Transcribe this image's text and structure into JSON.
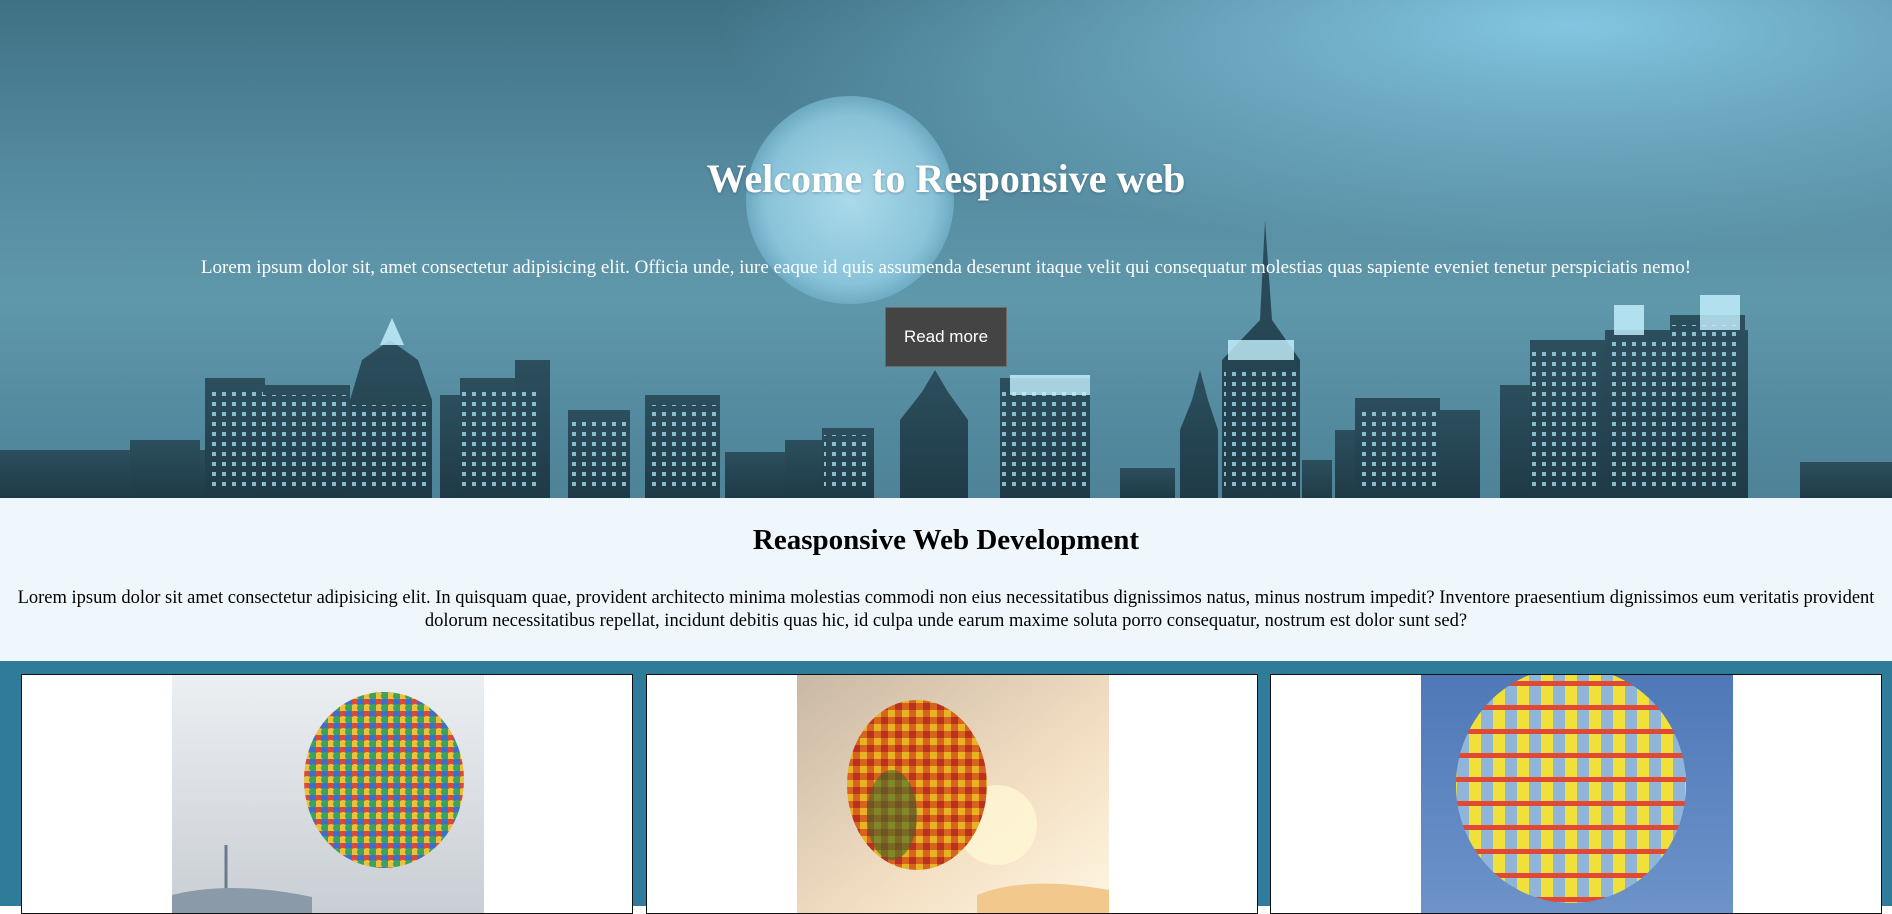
{
  "hero": {
    "title": "Welcome to Responsive web",
    "text": "Lorem ipsum dolor sit, amet consectetur adipisicing elit. Officia unde, iure eaque id quis assumenda deserunt itaque velit qui consequatur molestias quas sapiente eveniet tenetur perspiciatis nemo!",
    "button_label": "Read more",
    "background": "night-city-skyline-image"
  },
  "intro": {
    "title": "Reasponsive Web Development",
    "text": "Lorem ipsum dolor sit amet consectetur adipisicing elit. In quisquam quae, provident architecto minima molestias commodi non eius necessitatibus dignissimos natus, minus nostrum impedit? Inventore praesentium dignissimos eum veritatis provident dolorum necessitatibus repellat, incidunt debitis quas hic, id culpa unde earum maxime soluta porro consequatur, nostrum est dolor sunt sed?"
  },
  "cards": [
    {
      "image": "balloon-cluster-image"
    },
    {
      "image": "sunset-hot-air-balloon-image"
    },
    {
      "image": "striped-hot-air-balloon-image"
    }
  ],
  "colors": {
    "hero_tint": "#5f97ab",
    "button_bg": "#444444",
    "intro_bg": "#eff7fd",
    "cards_bg": "#2e7c99"
  }
}
